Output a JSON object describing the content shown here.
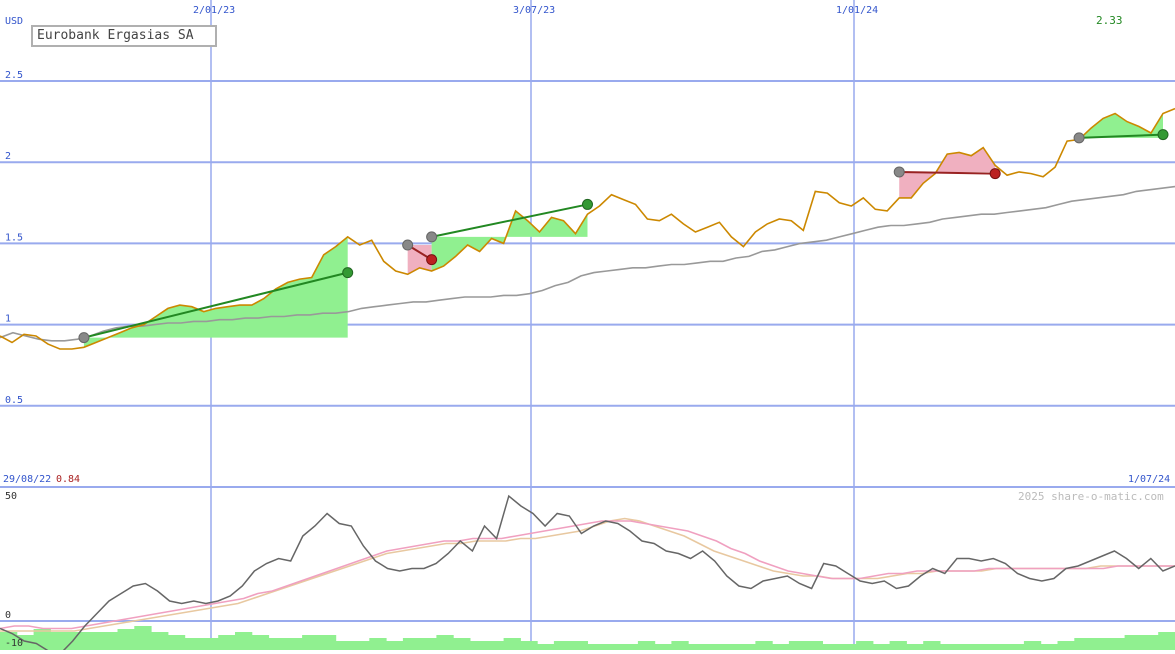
{
  "chart_data": [
    {
      "type": "line",
      "title": "Eurobank Ergasias SA",
      "currency": "USD",
      "y_ticks": [
        "2.5",
        "2",
        "1.5",
        "1",
        "0.5"
      ],
      "ylim": [
        0,
        2.5
      ],
      "x_ticks": [
        "2/01/23",
        "3/07/23",
        "1/01/24"
      ],
      "start_label": "29/08/22",
      "start_value": "0.84",
      "end_label": "1/07/24",
      "last_value": "2.33",
      "copyright": "2025 share-o-matic.com",
      "grid": true,
      "series": [
        {
          "role": "price",
          "color": "#cc8800",
          "values": [
            0.93,
            0.89,
            0.94,
            0.93,
            0.88,
            0.85,
            0.85,
            0.86,
            0.89,
            0.92,
            0.95,
            0.98,
            1.0,
            1.05,
            1.1,
            1.12,
            1.11,
            1.08,
            1.1,
            1.11,
            1.12,
            1.12,
            1.16,
            1.22,
            1.26,
            1.28,
            1.29,
            1.43,
            1.48,
            1.54,
            1.49,
            1.52,
            1.39,
            1.33,
            1.31,
            1.35,
            1.33,
            1.36,
            1.42,
            1.49,
            1.45,
            1.53,
            1.5,
            1.7,
            1.64,
            1.57,
            1.66,
            1.64,
            1.56,
            1.68,
            1.73,
            1.8,
            1.77,
            1.74,
            1.65,
            1.64,
            1.68,
            1.62,
            1.57,
            1.6,
            1.63,
            1.54,
            1.48,
            1.57,
            1.62,
            1.65,
            1.64,
            1.58,
            1.82,
            1.81,
            1.75,
            1.73,
            1.78,
            1.71,
            1.7,
            1.78,
            1.78,
            1.87,
            1.93,
            2.05,
            2.06,
            2.04,
            2.09,
            1.98,
            1.92,
            1.94,
            1.93,
            1.91,
            1.97,
            2.13,
            2.14,
            2.21,
            2.27,
            2.3,
            2.25,
            2.22,
            2.18,
            2.3,
            2.33
          ]
        },
        {
          "role": "moving-average",
          "color": "#999999",
          "values": [
            0.92,
            0.95,
            0.93,
            0.91,
            0.9,
            0.9,
            0.91,
            0.93,
            0.96,
            0.98,
            0.99,
            0.99,
            1.0,
            1.01,
            1.01,
            1.02,
            1.02,
            1.03,
            1.03,
            1.04,
            1.04,
            1.05,
            1.05,
            1.06,
            1.06,
            1.07,
            1.07,
            1.08,
            1.1,
            1.11,
            1.12,
            1.13,
            1.14,
            1.14,
            1.15,
            1.16,
            1.17,
            1.17,
            1.17,
            1.18,
            1.18,
            1.19,
            1.21,
            1.24,
            1.26,
            1.3,
            1.32,
            1.33,
            1.34,
            1.35,
            1.35,
            1.36,
            1.37,
            1.37,
            1.38,
            1.39,
            1.39,
            1.41,
            1.42,
            1.45,
            1.46,
            1.48,
            1.5,
            1.51,
            1.52,
            1.54,
            1.56,
            1.58,
            1.6,
            1.61,
            1.61,
            1.62,
            1.63,
            1.65,
            1.66,
            1.67,
            1.68,
            1.68,
            1.69,
            1.7,
            1.71,
            1.72,
            1.74,
            1.76,
            1.77,
            1.78,
            1.79,
            1.8,
            1.82,
            1.83,
            1.84,
            1.85
          ]
        }
      ],
      "trades": [
        {
          "buy": 0.92,
          "sell": 1.32,
          "result": "gain"
        },
        {
          "buy": 1.49,
          "sell": 1.4,
          "result": "loss"
        },
        {
          "buy": 1.54,
          "sell": 1.74,
          "result": "gain"
        },
        {
          "buy": 1.94,
          "sell": 1.93,
          "result": "loss"
        },
        {
          "buy": 2.15,
          "sell": 2.17,
          "result": "gain"
        }
      ]
    },
    {
      "type": "line",
      "y_ticks": [
        "50",
        "0",
        "-10"
      ],
      "ylim": [
        -10,
        60
      ],
      "series": [
        {
          "role": "oscillator",
          "color": "#666666",
          "values": [
            -3,
            -5,
            -8,
            -9,
            -12,
            -13,
            -8,
            -2,
            3,
            8,
            11,
            14,
            15,
            12,
            8,
            7,
            8,
            7,
            8,
            10,
            14,
            20,
            23,
            25,
            24,
            34,
            38,
            43,
            39,
            38,
            30,
            24,
            21,
            20,
            21,
            21,
            23,
            27,
            32,
            28,
            38,
            33,
            50,
            46,
            43,
            38,
            43,
            42,
            35,
            38,
            40,
            39,
            36,
            32,
            31,
            28,
            27,
            25,
            28,
            24,
            18,
            14,
            13,
            16,
            17,
            18,
            15,
            13,
            23,
            22,
            19,
            16,
            15,
            16,
            13,
            14,
            18,
            21,
            19,
            25,
            25,
            24,
            25,
            23,
            19,
            17,
            16,
            17,
            21,
            22,
            24,
            26,
            28,
            25,
            21,
            25,
            20,
            22
          ]
        },
        {
          "role": "signal-fast",
          "color": "#f0a0c0",
          "values": [
            -3,
            -2,
            -2,
            -3,
            -3,
            -3,
            -2,
            -1,
            0,
            1,
            2,
            3,
            4,
            5,
            6,
            7,
            8,
            9,
            11,
            12,
            14,
            16,
            18,
            20,
            22,
            24,
            26,
            28,
            29,
            30,
            31,
            32,
            32,
            33,
            33,
            33,
            34,
            35,
            36,
            37,
            38,
            39,
            40,
            40,
            40,
            39,
            38,
            37,
            36,
            34,
            32,
            29,
            27,
            24,
            22,
            20,
            19,
            18,
            17,
            17,
            17,
            18,
            19,
            19,
            20,
            20,
            20,
            20,
            20,
            21,
            21,
            21,
            21,
            21,
            21,
            21,
            21,
            21,
            22,
            22,
            22,
            22,
            22
          ]
        },
        {
          "role": "signal-slow",
          "color": "#e8c8a0",
          "values": [
            -4,
            -4,
            -4,
            -4,
            -4,
            -4,
            -3,
            -2,
            -1,
            0,
            1,
            2,
            3,
            4,
            5,
            6,
            7,
            9,
            11,
            13,
            15,
            17,
            19,
            21,
            23,
            25,
            27,
            28,
            29,
            30,
            31,
            31,
            32,
            32,
            32,
            33,
            33,
            34,
            35,
            36,
            38,
            40,
            41,
            40,
            38,
            36,
            34,
            31,
            28,
            26,
            24,
            22,
            20,
            19,
            18,
            18,
            17,
            17,
            17,
            17,
            18,
            19,
            19,
            20,
            20,
            20,
            20,
            21,
            21,
            21,
            21,
            21,
            21,
            21,
            22,
            22,
            22,
            22,
            22,
            22
          ]
        },
        {
          "role": "volume-bars",
          "color": "#90f090",
          "values": [
            6,
            5,
            7,
            6,
            6,
            6,
            6,
            7,
            8,
            6,
            5,
            4,
            4,
            5,
            6,
            5,
            4,
            4,
            5,
            5,
            3,
            3,
            4,
            3,
            4,
            4,
            5,
            4,
            3,
            3,
            4,
            3,
            2,
            3,
            3,
            2,
            2,
            2,
            3,
            2,
            3,
            2,
            2,
            2,
            2,
            3,
            2,
            3,
            3,
            2,
            2,
            3,
            2,
            3,
            2,
            3,
            2,
            2,
            2,
            2,
            2,
            3,
            2,
            3,
            4,
            4,
            4,
            5,
            5,
            6
          ]
        }
      ]
    }
  ]
}
